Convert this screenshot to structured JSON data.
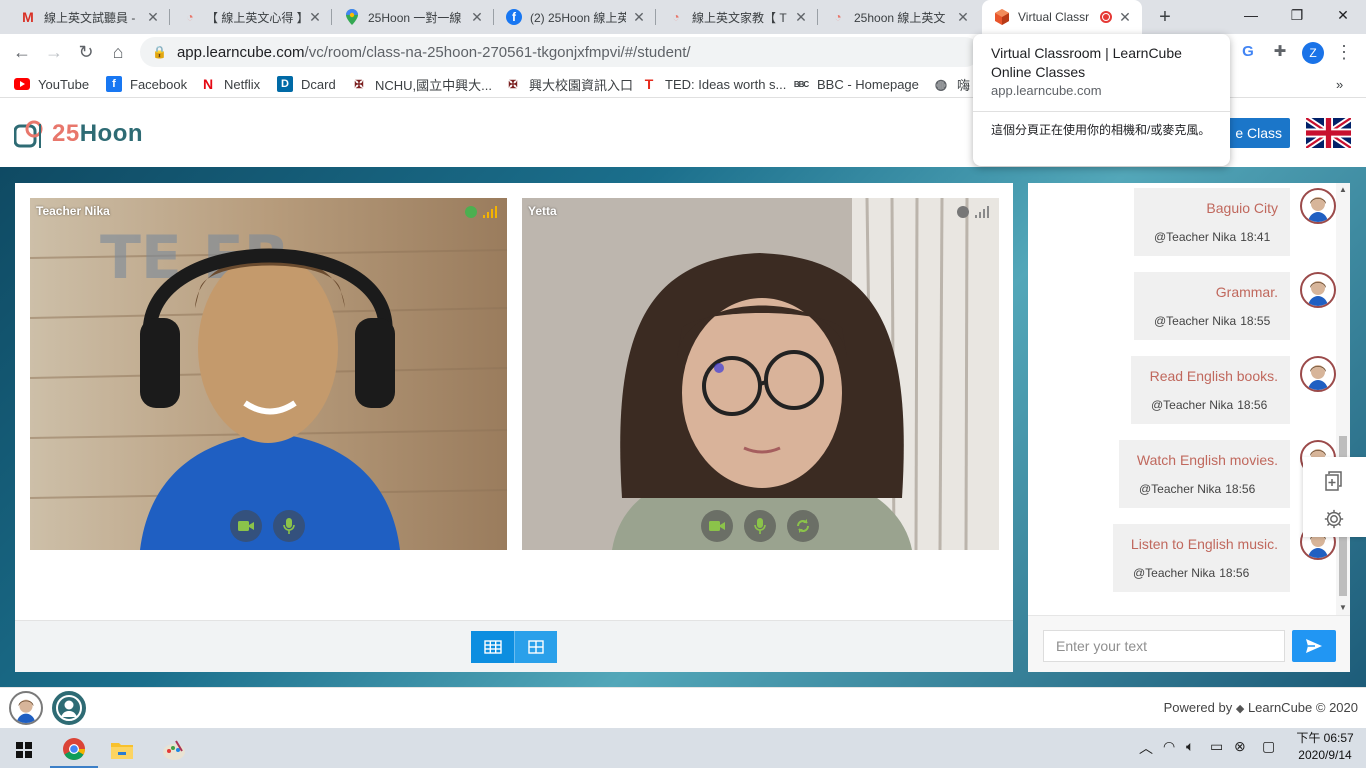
{
  "browser": {
    "tabs": [
      {
        "title": "線上英文試聽員 - ",
        "icon": "gmail-icon",
        "color": "#d93025"
      },
      {
        "title": "【 線上英文心得 】",
        "icon": "25hoon-logo-icon",
        "color": "#e8776c"
      },
      {
        "title": "25Hoon 一對一線",
        "icon": "maps-icon",
        "color": "#34a853"
      },
      {
        "title": "(2) 25Hoon 線上英",
        "icon": "facebook-icon",
        "color": "#1877f2"
      },
      {
        "title": "線上英文家教【 T",
        "icon": "25hoon-logo-icon",
        "color": "#e8776c"
      },
      {
        "title": "25hoon 線上英文",
        "icon": "25hoon-logo-icon",
        "color": "#e8776c"
      },
      {
        "title": "Virtual Classr",
        "icon": "learncube-icon",
        "color": "#e8552b",
        "active": true
      }
    ],
    "url": {
      "host": "app.learncube.com",
      "path": "/vc/room/class-na-25hoon-270561-tkgonjxfmpvi/#/student/"
    },
    "profile_initial": "Z",
    "bookmarks": [
      {
        "label": "YouTube",
        "icon": "youtube-icon"
      },
      {
        "label": "Facebook",
        "icon": "facebook-icon"
      },
      {
        "label": "Netflix",
        "icon": "netflix-icon"
      },
      {
        "label": "Dcard",
        "icon": "dcard-icon"
      },
      {
        "label": "NCHU,國立中興大...",
        "icon": "nchu-icon"
      },
      {
        "label": "興大校園資訊入口",
        "icon": "nchu-icon"
      },
      {
        "label": "TED: Ideas worth s...",
        "icon": "ted-icon"
      },
      {
        "label": "BBC - Homepage",
        "icon": "bbc-icon"
      },
      {
        "label": "嗨",
        "icon": "globe-icon"
      }
    ],
    "bookmarks_overflow": "»"
  },
  "tooltip": {
    "title": "Virtual Classroom | LearnCube Online Classes",
    "url": "app.learncube.com",
    "note": "這個分頁正在使用你的相機和/或麥克風。"
  },
  "site": {
    "logo_number": "25",
    "logo_word": "Hoon",
    "leave_label": "e Class",
    "language": "English (UK flag)"
  },
  "videos": [
    {
      "name": "Teacher Nika",
      "status_color": "#4caf50",
      "signal_color": "#f5b400"
    },
    {
      "name": "Yetta",
      "status_color": "#777777",
      "signal_color": "#8a8a8a"
    }
  ],
  "chat": {
    "messages": [
      {
        "text": "Baguio City",
        "author": "@Teacher Nika",
        "time": "18:41"
      },
      {
        "text": "Grammar.",
        "author": "@Teacher Nika",
        "time": "18:55"
      },
      {
        "text": "Read English books.",
        "author": "@Teacher Nika",
        "time": "18:56"
      },
      {
        "text": "Watch English movies.",
        "author": "@Teacher Nika",
        "time": "18:56"
      },
      {
        "text": "Listen to English music.",
        "author": "@Teacher Nika",
        "time": "18:56"
      }
    ],
    "input_placeholder": "Enter your text"
  },
  "footer": {
    "powered_prefix": "Powered by",
    "powered_brand": "LearnCube © 2020"
  },
  "taskbar": {
    "time": "下午 06:57",
    "date": "2020/9/14"
  },
  "colors": {
    "accent": "#1b76c9",
    "chat_text": "#c0685d",
    "logo_coral": "#e8776c",
    "logo_teal": "#2e6b74"
  }
}
